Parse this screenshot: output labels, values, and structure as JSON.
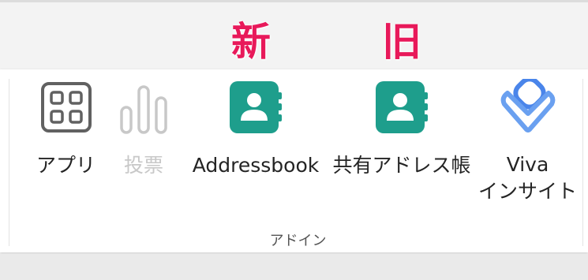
{
  "annotations": {
    "new_label": "新",
    "old_label": "旧",
    "color": "#e8195a"
  },
  "ribbon": {
    "group_label": "アドイン",
    "items": [
      {
        "label": "アプリ",
        "icon": "apps-grid-icon",
        "enabled": true
      },
      {
        "label": "投票",
        "icon": "poll-bars-icon",
        "enabled": false
      },
      {
        "label": "Addressbook",
        "icon": "addressbook-icon",
        "enabled": true,
        "color": "#1e9e8c"
      },
      {
        "label": "共有アドレス帳",
        "icon": "addressbook-icon",
        "enabled": true,
        "color": "#1e9e8c"
      },
      {
        "label_line1": "Viva",
        "label_line2": "インサイト",
        "icon": "viva-insights-icon",
        "enabled": true,
        "color": "#4a85ea"
      }
    ]
  }
}
